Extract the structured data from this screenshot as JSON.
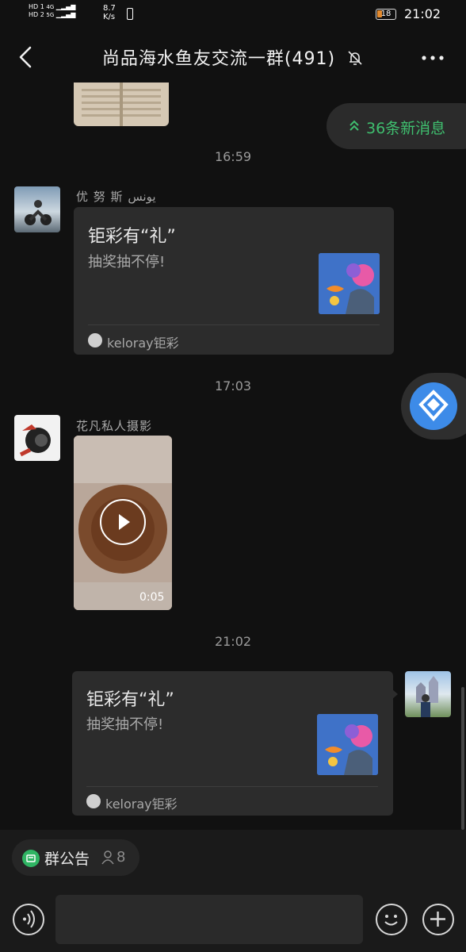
{
  "status_bar": {
    "network_labels": [
      "HD 1",
      "HD 2"
    ],
    "signal_labels": [
      "4G",
      "5G"
    ],
    "speed": "8.7",
    "speed_unit": "K/s",
    "battery": "18",
    "time": "21:02"
  },
  "header": {
    "title": "尚品海水鱼友交流一群(491)",
    "back_icon": "chevron-left-icon",
    "mute_icon": "bell-off-icon",
    "more_icon": "more-dots-icon"
  },
  "new_messages": {
    "label": "36条新消息",
    "icon": "double-chevron-up-icon"
  },
  "messages": [
    {
      "time": "16:59"
    },
    {
      "sender": "优 努 斯  يونس",
      "card": {
        "title": "钜彩有“礼”",
        "desc": "抽奖抽不停!",
        "source": "keloray钜彩"
      }
    },
    {
      "time": "17:03"
    },
    {
      "sender": "花凡私人摄影",
      "video": {
        "duration": "0:05"
      }
    },
    {
      "time": "21:02"
    },
    {
      "self": true,
      "card": {
        "title": "钜彩有“礼”",
        "desc": "抽奖抽不停!",
        "source": "keloray钜彩"
      }
    }
  ],
  "group_notice": {
    "label": "群公告",
    "count": "8"
  },
  "colors": {
    "accent": "#3fbf6f",
    "background": "#111111",
    "card": "#2c2c2c",
    "floating_button": "#3d8be8"
  }
}
